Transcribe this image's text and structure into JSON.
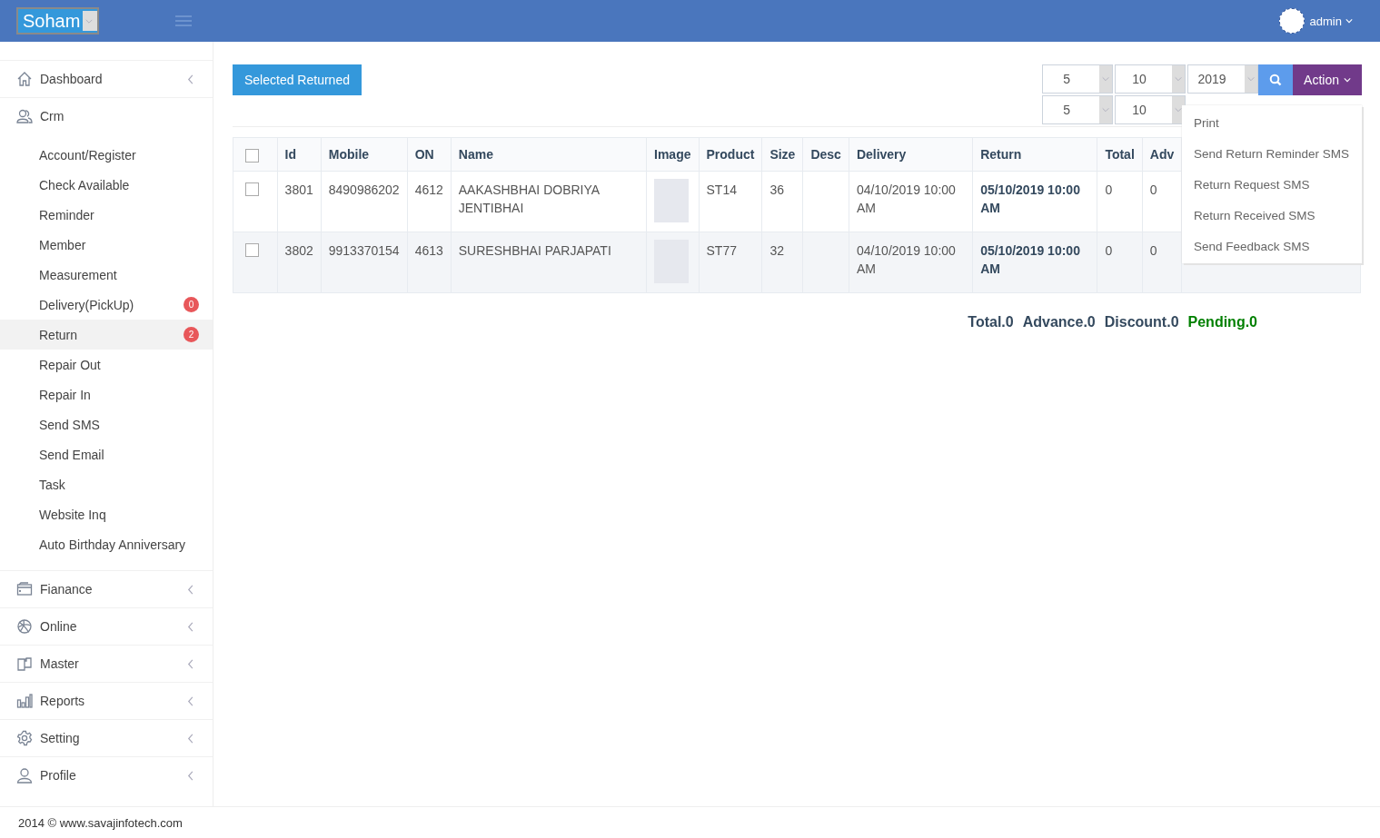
{
  "header": {
    "brand": "Soham",
    "user": "admin"
  },
  "sidebar": {
    "items": [
      {
        "label": "Dashboard",
        "expanded": false
      },
      {
        "label": "Crm",
        "expanded": true,
        "children": [
          {
            "label": "Account/Register",
            "selected": false
          },
          {
            "label": "Check Available",
            "selected": false
          },
          {
            "label": "Reminder",
            "selected": false
          },
          {
            "label": "Member",
            "selected": false
          },
          {
            "label": "Measurement",
            "selected": false
          },
          {
            "label": "Delivery(PickUp)",
            "selected": false,
            "badge": "0"
          },
          {
            "label": "Return",
            "selected": true,
            "badge": "2"
          },
          {
            "label": "Repair Out",
            "selected": false
          },
          {
            "label": "Repair In",
            "selected": false
          },
          {
            "label": "Send SMS",
            "selected": false
          },
          {
            "label": "Send Email",
            "selected": false
          },
          {
            "label": "Task",
            "selected": false
          },
          {
            "label": "Website Inq",
            "selected": false
          },
          {
            "label": "Auto Birthday Anniversary",
            "selected": false
          }
        ]
      },
      {
        "label": "Fianance",
        "expanded": false
      },
      {
        "label": "Online",
        "expanded": false
      },
      {
        "label": "Master",
        "expanded": false
      },
      {
        "label": "Reports",
        "expanded": false
      },
      {
        "label": "Setting",
        "expanded": false
      },
      {
        "label": "Profile",
        "expanded": false
      }
    ]
  },
  "toolbar": {
    "primary_button": "Selected Returned",
    "filters_row_1": [
      "5",
      "10",
      "2019"
    ],
    "filters_row_2": [
      "5",
      "10"
    ],
    "action_button": "Action",
    "action_menu": [
      "Print",
      "Send Return Reminder SMS",
      "Return Request SMS",
      "Return Received SMS",
      "Send Feedback SMS"
    ]
  },
  "table": {
    "select_all_checked": false,
    "columns": [
      "Id",
      "Mobile",
      "ON",
      "Name",
      "Image",
      "Product",
      "Size",
      "Desc",
      "Delivery",
      "Return",
      "Total",
      "Adv"
    ],
    "rows": [
      {
        "checked": false,
        "id": "3801",
        "mobile": "8490986202",
        "on": "4612",
        "name": "AAKASHBHAI DOBRIYA JENTIBHAI",
        "product": "ST14",
        "size": "36",
        "desc": "",
        "delivery": "04/10/2019 10:00 AM",
        "return": "05/10/2019 10:00 AM",
        "total": "0",
        "adv": "0"
      },
      {
        "checked": false,
        "id": "3802",
        "mobile": "9913370154",
        "on": "4613",
        "name": "SURESHBHAI PARJAPATI",
        "product": "ST77",
        "size": "32",
        "desc": "",
        "delivery": "04/10/2019 10:00 AM",
        "return": "05/10/2019 10:00 AM",
        "total": "0",
        "adv": "0"
      }
    ]
  },
  "summary": [
    {
      "label": "Total.0",
      "color": "#34495e"
    },
    {
      "label": "Advance.0",
      "color": "#34495e"
    },
    {
      "label": "Discount.0",
      "color": "#34495e"
    },
    {
      "label": "Pending.0",
      "color": "#008000"
    }
  ],
  "footer": "2014 © www.savajinfotech.com"
}
